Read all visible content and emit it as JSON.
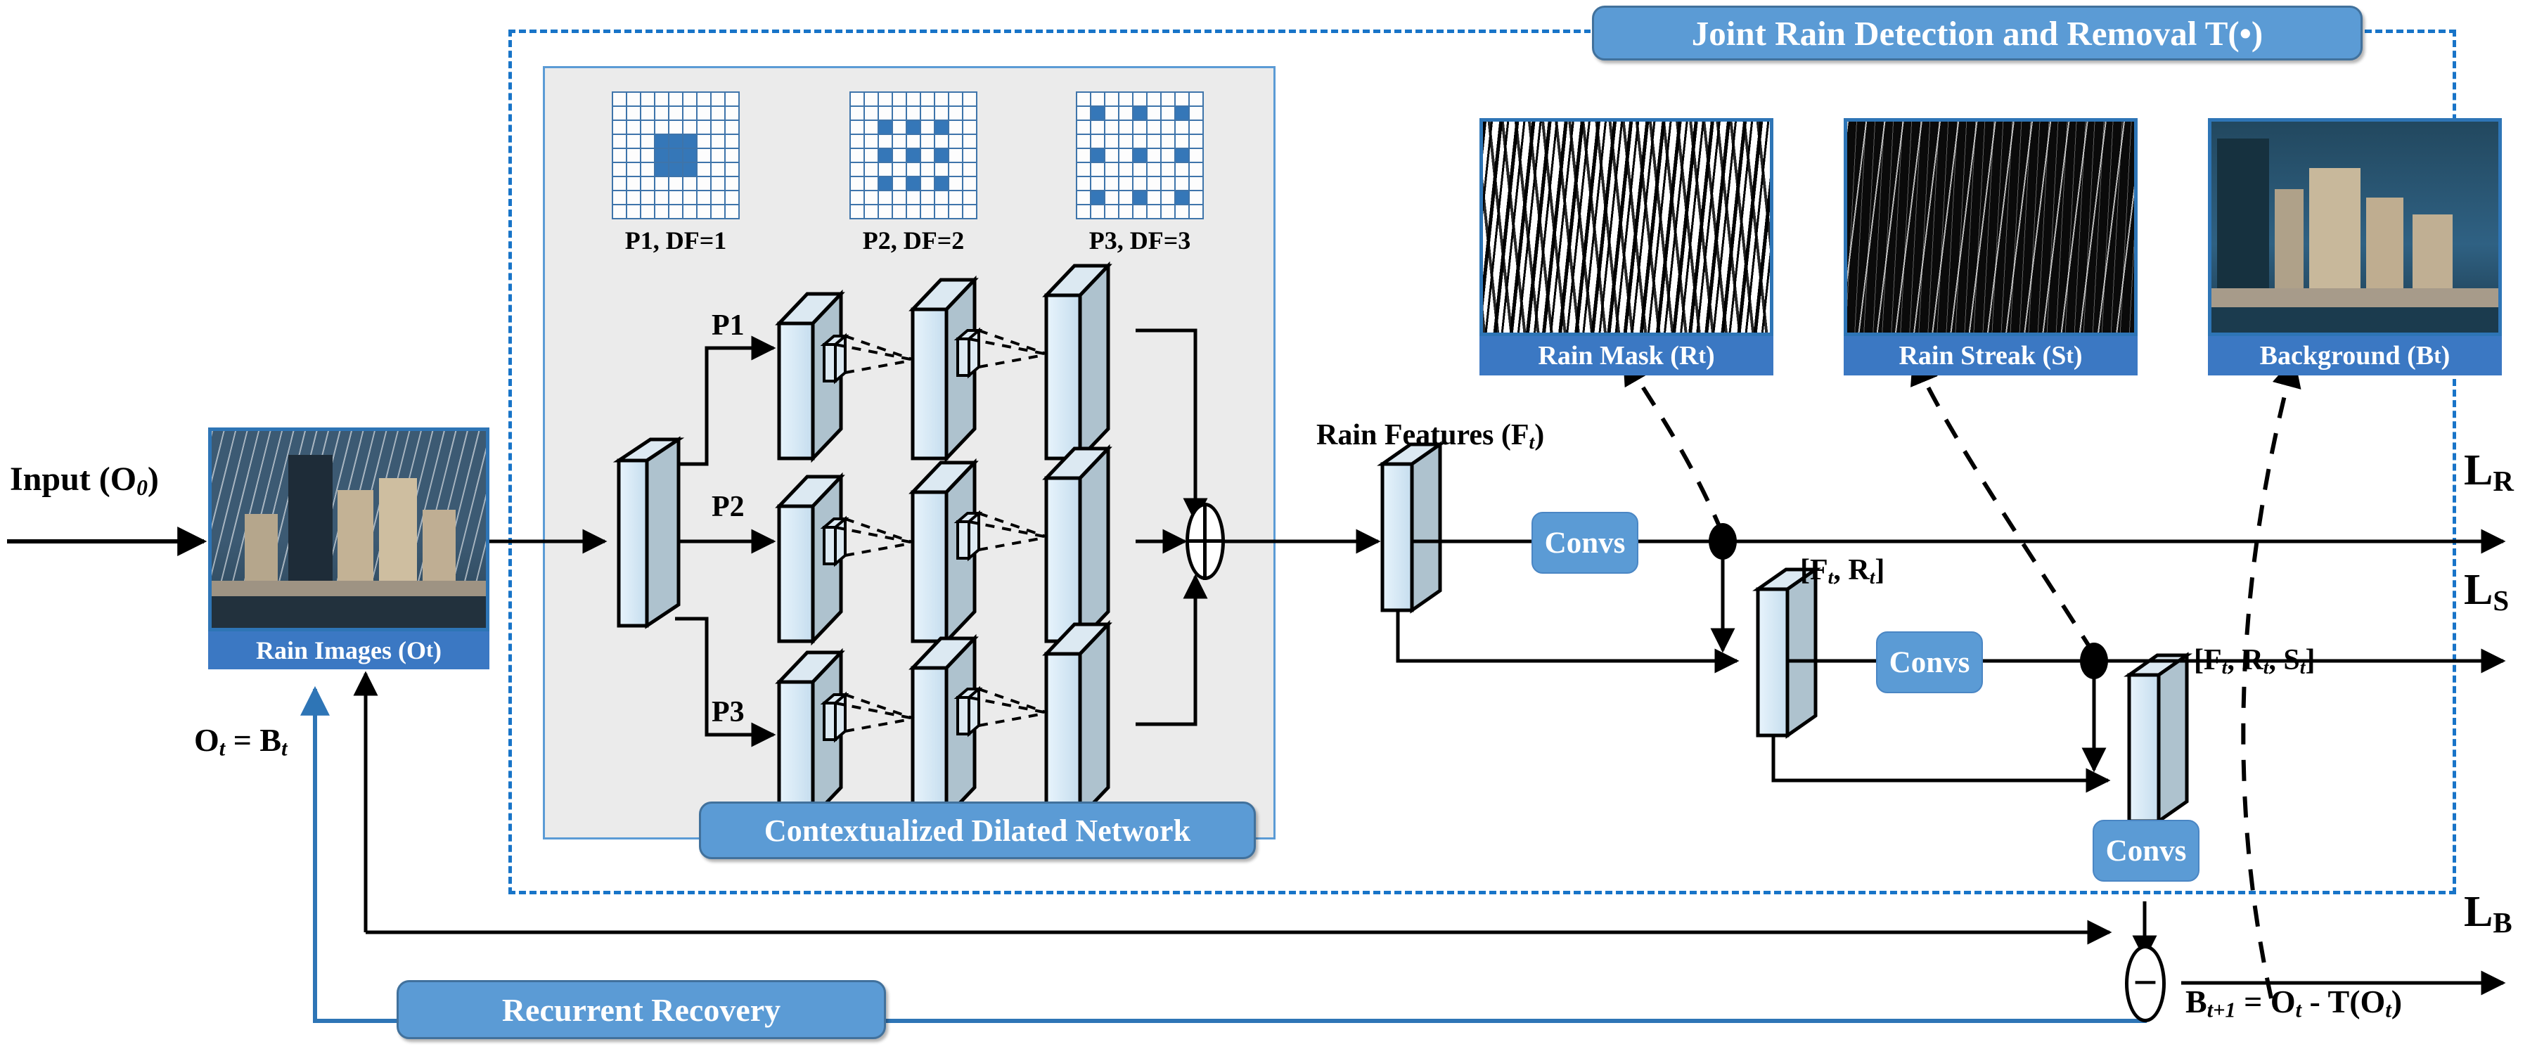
{
  "title_banner": {
    "label": "Joint Rain Detection and Removal T(•)"
  },
  "input": {
    "label_text": "Input (O",
    "label_sub": "0",
    "label_tail": ")",
    "card_caption_text": "Rain Images (O",
    "card_caption_sub": "t",
    "card_caption_tail": ")"
  },
  "dilated_network": {
    "banner": "Contextualized Dilated Network",
    "branch_labels": [
      "P1",
      "P2",
      "P3"
    ],
    "kernels": [
      {
        "caption": "P1, DF=1",
        "size": 9,
        "df": 1
      },
      {
        "caption": "P2, DF=2",
        "size": 9,
        "df": 2
      },
      {
        "caption": "P3, DF=3",
        "size": 9,
        "df": 3
      }
    ],
    "sum_operator": "⊕"
  },
  "recurrent": {
    "banner": "Recurrent Recovery",
    "formula_head": "O",
    "formula_sub1": "t",
    "formula_mid": " = B",
    "formula_sub2": "t"
  },
  "rain_features": {
    "label_head": "Rain Features (F",
    "label_sub": "t",
    "label_tail": ")"
  },
  "convs": [
    {
      "label": "Convs"
    },
    {
      "label": "Convs"
    },
    {
      "label": "Convs"
    }
  ],
  "concat_labels": [
    {
      "parts": [
        "[F",
        "t",
        ", R",
        "t",
        "]"
      ]
    },
    {
      "parts": [
        "[F",
        "t",
        ", R",
        "t",
        ", S",
        "t",
        "]"
      ]
    }
  ],
  "outputs": [
    {
      "caption_head": "Rain Mask (R",
      "caption_sub": "t",
      "caption_tail": ")",
      "kind": "rain-mask"
    },
    {
      "caption_head": "Rain Streak (S",
      "caption_sub": "t",
      "caption_tail": ")",
      "kind": "rain-streak"
    },
    {
      "caption_head": "Background (B",
      "caption_sub": "t",
      "caption_tail": ")",
      "kind": "background"
    }
  ],
  "losses": [
    {
      "head": "L",
      "sub": "R"
    },
    {
      "head": "L",
      "sub": "S"
    },
    {
      "head": "L",
      "sub": "B"
    }
  ],
  "bottom_formula": {
    "p1": "B",
    "s1": "t+1",
    "p2": " = O",
    "s2": "t",
    "p3": " - T(O",
    "s3": "t",
    "p4": ")"
  },
  "minus_operator": "−",
  "colors": {
    "accent_blue": "#5B9BD5",
    "dashed_blue": "#1874C8",
    "panel_gray": "#EBEBEB",
    "caption_blue": "#3B78C3",
    "grid_blue": "#3577B8",
    "slab_front": "#D6EAF8",
    "slab_side": "#ADC2CE",
    "stroke_black": "#000000"
  }
}
